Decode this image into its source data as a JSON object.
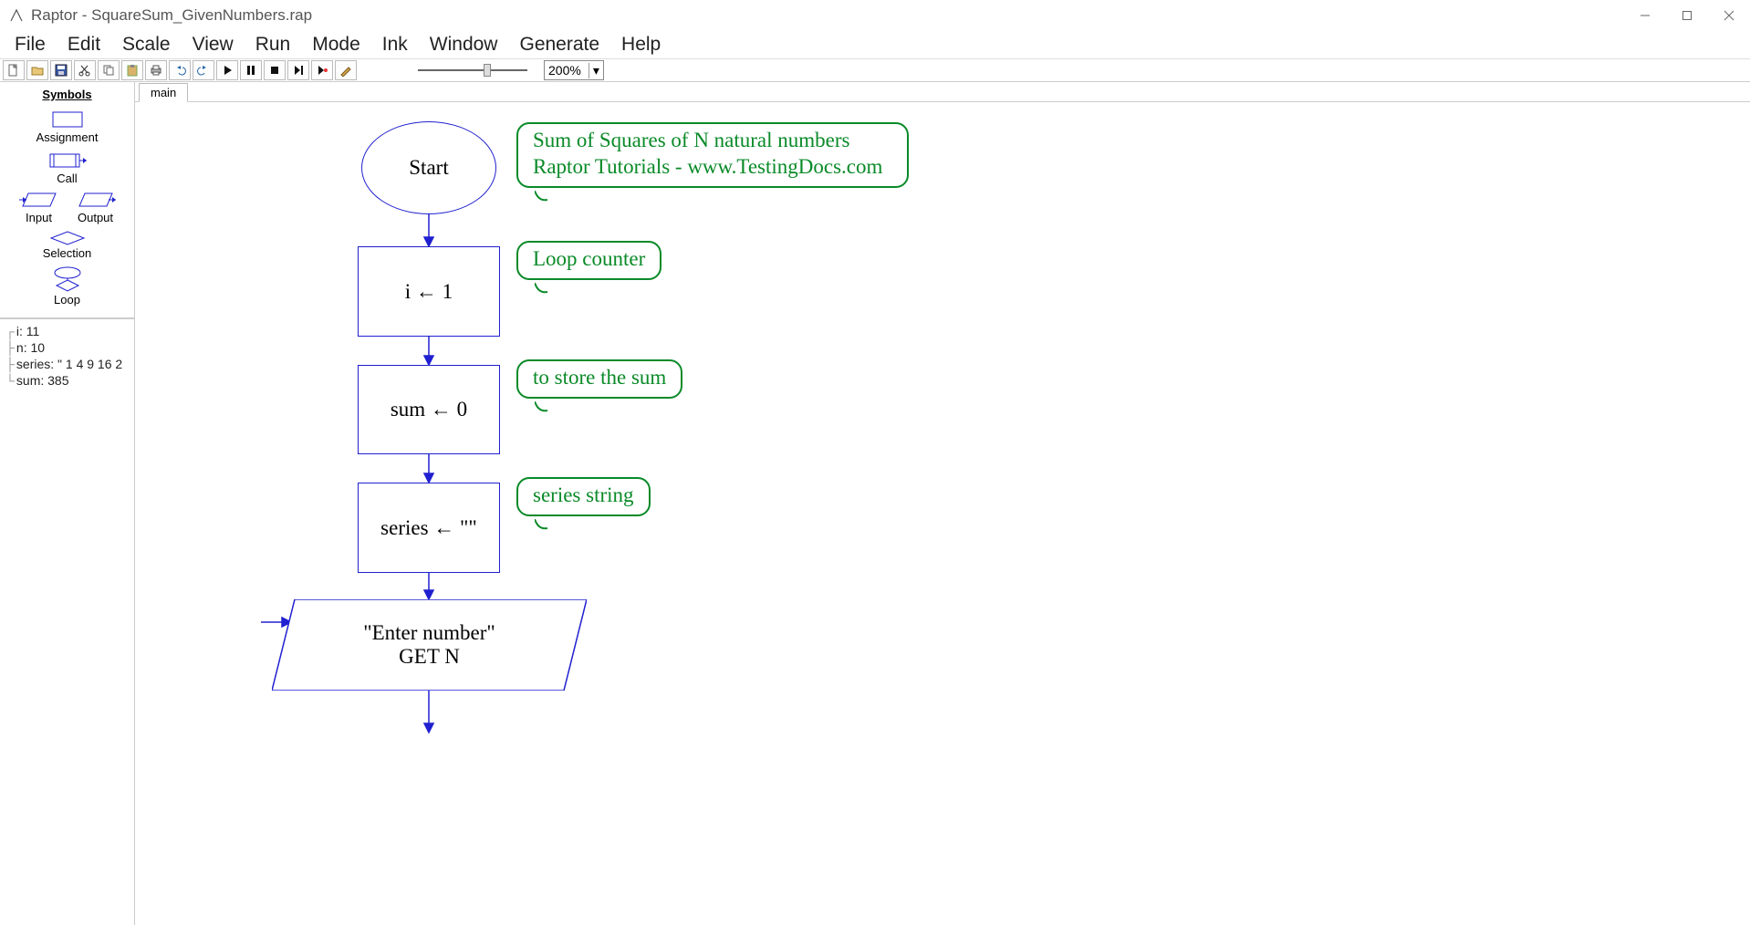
{
  "window": {
    "title": "Raptor - SquareSum_GivenNumbers.rap"
  },
  "menu": {
    "items": [
      "File",
      "Edit",
      "Scale",
      "View",
      "Run",
      "Mode",
      "Ink",
      "Window",
      "Generate",
      "Help"
    ]
  },
  "zoom": {
    "value": "200%"
  },
  "symbols": {
    "header": "Symbols",
    "assignment": "Assignment",
    "call": "Call",
    "input": "Input",
    "output": "Output",
    "selection": "Selection",
    "loop": "Loop"
  },
  "watch": {
    "rows": [
      "i: 11",
      "n: 10",
      "series: \" 1 4 9 16 2",
      "sum: 385"
    ]
  },
  "tab": {
    "label": "main"
  },
  "flowchart": {
    "start": "Start",
    "assign1": "i ← 1",
    "assign2": "sum ← 0",
    "assign3": "series ← \"\"",
    "input_line1": "\"Enter number\"",
    "input_line2": "GET N",
    "comment_title_l1": "Sum of Squares of N natural numbers",
    "comment_title_l2": "Raptor Tutorials - www.TestingDocs.com",
    "comment_c1": "Loop counter",
    "comment_c2": "to store the sum",
    "comment_c3": "series string"
  }
}
